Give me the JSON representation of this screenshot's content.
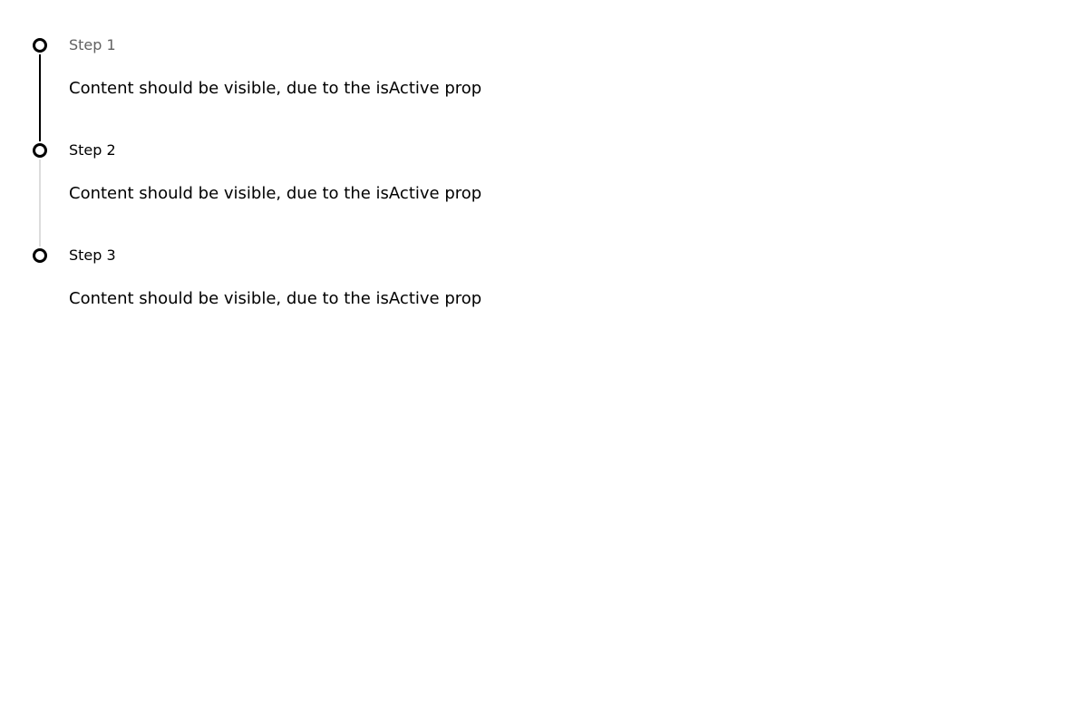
{
  "colors": {
    "active_line": "#000000",
    "inactive_line": "#dcdcdc",
    "label_muted": "#616161",
    "text": "#000000"
  },
  "steps": [
    {
      "label": "Step 1",
      "content": "Content should be visible, due to the isActive prop",
      "icon": "step-indicator-icon",
      "connector": "active"
    },
    {
      "label": "Step 2",
      "content": "Content should be visible, due to the isActive prop",
      "icon": "step-indicator-icon",
      "connector": "inactive"
    },
    {
      "label": "Step 3",
      "content": "Content should be visible, due to the isActive prop",
      "icon": "step-indicator-icon",
      "connector": "none"
    }
  ]
}
